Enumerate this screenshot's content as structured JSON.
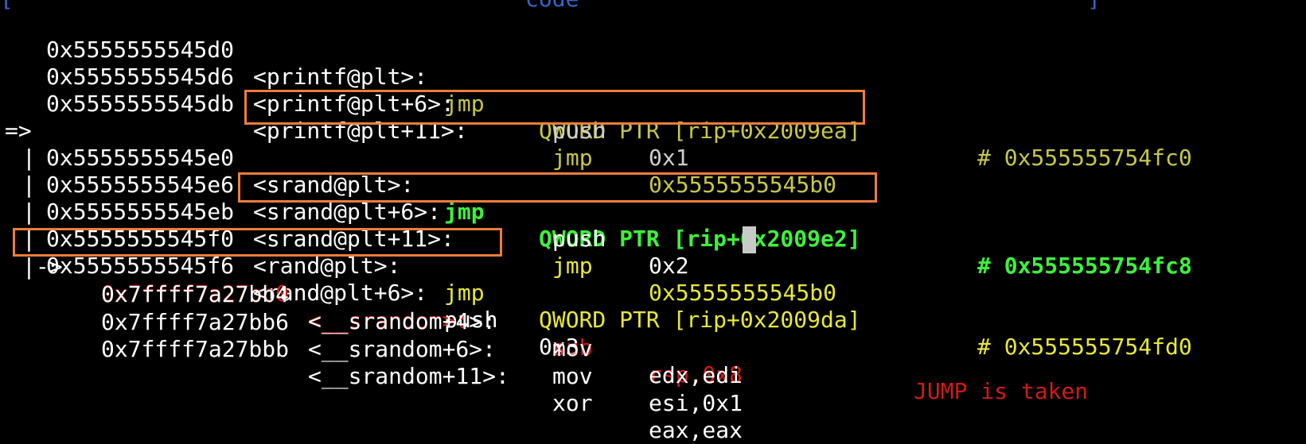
{
  "header": {
    "left_bracket": "[",
    "title": "code",
    "right_bracket": "]"
  },
  "colors": {
    "white": "#ffffff",
    "olive": "#c7c74a",
    "grey": "#cfcfcf",
    "bright_green": "#3df23d",
    "yellow": "#e8e83a",
    "red": "#d21919",
    "highlight_box": "#f07d3a",
    "header": "#3b63c8"
  },
  "lines": [
    {
      "prefix": "",
      "addr": "0x5555555545d0",
      "sym": "<printf@plt>:",
      "mnem": "jmp",
      "ops": "QWORD PTR [rip+0x2009ea]",
      "comment": "# 0x555555754fc0"
    },
    {
      "prefix": "",
      "addr": "0x5555555545d6",
      "sym": "<printf@plt+6>:",
      "mnem": "push",
      "ops": "0x1",
      "comment": ""
    },
    {
      "prefix": "",
      "addr": "0x5555555545db",
      "sym": "<printf@plt+11>:",
      "mnem": "jmp",
      "ops": "0x5555555545b0",
      "comment": ""
    },
    {
      "prefix": "=>",
      "addr": "0x5555555545e0",
      "sym": "<srand@plt>:",
      "mnem": "jmp",
      "ops": "QWORD PTR [rip+0x2009e2]",
      "comment": "# 0x555555754fc8"
    },
    {
      "prefix": "|",
      "addr": "0x5555555545e6",
      "sym": "<srand@plt+6>:",
      "mnem": "push",
      "ops": "0x2",
      "comment": ""
    },
    {
      "prefix": "|",
      "addr": "0x5555555545eb",
      "sym": "<srand@plt+11>:",
      "mnem": "jmp",
      "ops": "0x5555555545b0",
      "comment": ""
    },
    {
      "prefix": "|",
      "addr": "0x5555555545f0",
      "sym": "<rand@plt>:",
      "mnem": "jmp",
      "ops": "QWORD PTR [rip+0x2009da]",
      "comment": "# 0x555555754fd0"
    },
    {
      "prefix": "|",
      "addr": "0x5555555545f6",
      "sym": "<rand@plt+6>:",
      "mnem": "push",
      "ops": "0x3",
      "comment": ""
    },
    {
      "prefix": "|->",
      "addr": "0x7ffff7a27bb0",
      "sym": "<__srandom>:",
      "mnem": "sub",
      "ops": "rsp,0x8",
      "comment": ""
    },
    {
      "prefix": "",
      "addr": "0x7ffff7a27bb4",
      "sym": "<__srandom+4>:",
      "mnem": "mov",
      "ops": "edx,edi",
      "comment": ""
    },
    {
      "prefix": "",
      "addr": "0x7ffff7a27bb6",
      "sym": "<__srandom+6>:",
      "mnem": "mov",
      "ops": "esi,0x1",
      "comment": ""
    },
    {
      "prefix": "",
      "addr": "0x7ffff7a27bbb",
      "sym": "<__srandom+11>:",
      "mnem": "xor",
      "ops": "eax,eax",
      "comment": ""
    }
  ],
  "status": {
    "jump_message": "JUMP is taken"
  }
}
